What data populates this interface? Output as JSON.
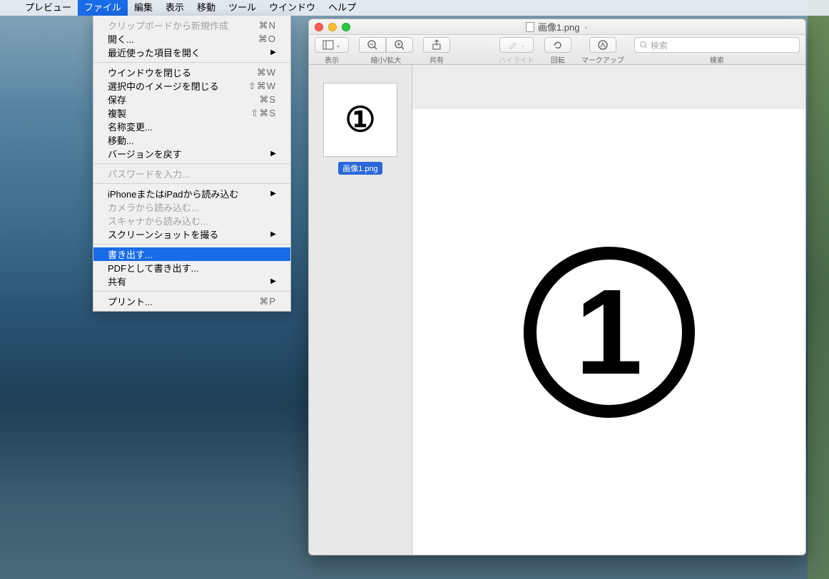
{
  "menubar": {
    "app": "プレビュー",
    "items": [
      "ファイル",
      "編集",
      "表示",
      "移動",
      "ツール",
      "ウインドウ",
      "ヘルプ"
    ],
    "selected": "ファイル"
  },
  "file_menu": {
    "items": [
      {
        "label": "クリップボードから新規作成",
        "shortcut": "⌘N",
        "disabled": true
      },
      {
        "label": "開く...",
        "shortcut": "⌘O"
      },
      {
        "label": "最近使った項目を開く",
        "arrow": true
      },
      {
        "sep": true
      },
      {
        "label": "ウインドウを閉じる",
        "shortcut": "⌘W"
      },
      {
        "label": "選択中のイメージを閉じる",
        "shortcut": "⇧⌘W"
      },
      {
        "label": "保存",
        "shortcut": "⌘S"
      },
      {
        "label": "複製",
        "shortcut": "⇧⌘S"
      },
      {
        "label": "名称変更..."
      },
      {
        "label": "移動..."
      },
      {
        "label": "バージョンを戻す",
        "arrow": true
      },
      {
        "sep": true
      },
      {
        "label": "パスワードを入力...",
        "disabled": true
      },
      {
        "sep": true
      },
      {
        "label": "iPhoneまたはiPadから読み込む",
        "arrow": true
      },
      {
        "label": "カメラから読み込む...",
        "disabled": true
      },
      {
        "label": "スキャナから読み込む...",
        "disabled": true
      },
      {
        "label": "スクリーンショットを撮る",
        "arrow": true
      },
      {
        "sep": true
      },
      {
        "label": "書き出す...",
        "selected": true
      },
      {
        "label": "PDFとして書き出す..."
      },
      {
        "label": "共有",
        "arrow": true
      },
      {
        "sep": true
      },
      {
        "label": "プリント...",
        "shortcut": "⌘P"
      }
    ]
  },
  "window": {
    "title": "画像1.png",
    "toolbar": {
      "view_label": "表示",
      "zoom_label": "縮小/拡大",
      "share_label": "共有",
      "highlight_label": "ハイライト",
      "rotate_label": "回転",
      "markup_label": "マークアップ",
      "search_label": "検索",
      "search_placeholder": "検索"
    },
    "thumb_label": "画像1.png",
    "content_glyph": "①",
    "big_glyph": "1"
  }
}
